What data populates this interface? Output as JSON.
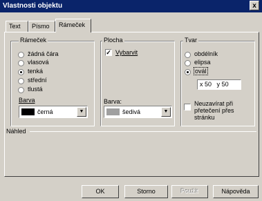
{
  "window": {
    "title": "Vlastnosti objektu",
    "close_label": "x"
  },
  "tabs": [
    {
      "label": "Text"
    },
    {
      "label": "Písmo"
    },
    {
      "label": "Rámeček"
    }
  ],
  "ramecek": {
    "title": "Rámeček",
    "options": [
      "žádná čára",
      "vlasová",
      "tenká",
      "střední",
      "tlustá"
    ],
    "selected": "tenká",
    "color_label": "Barva",
    "color_value": "černá",
    "color_swatch": "#000000"
  },
  "plocha": {
    "title": "Plocha",
    "fill_label": "Vybarvit",
    "fill_checked": true,
    "color_label": "Barva:",
    "color_value": "šedivá",
    "color_swatch": "#a0a0a0"
  },
  "tvar": {
    "title": "Tvar",
    "options": [
      "obdélník",
      "elipsa",
      "ovál"
    ],
    "selected": "ovál",
    "x_label": "x",
    "x_value": "50",
    "y_label": "y",
    "y_value": "50",
    "noclose_label": "Neuzavírat při přetečení přes stránku",
    "noclose_checked": false
  },
  "preview": {
    "title": "Náhled"
  },
  "buttons": {
    "ok": "OK",
    "cancel": "Storno",
    "apply": "Použít",
    "help": "Nápověda"
  },
  "check_mark": "✓",
  "dropdown_arrow": "▼"
}
